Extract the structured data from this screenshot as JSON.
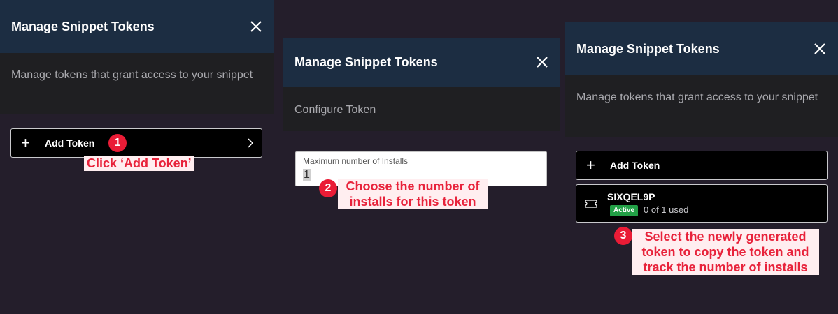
{
  "panel1": {
    "title": "Manage Snippet Tokens",
    "subtitle": "Manage tokens that grant access to your snippet",
    "add_token_label": "Add Token",
    "add_icon": "plus-icon",
    "chevron_icon": "chevron-right-icon",
    "step_number": "1",
    "callout": "Click ‘Add Token’"
  },
  "panel2": {
    "title": "Manage Snippet Tokens",
    "subtitle": "Configure Token",
    "field_label": "Maximum number of Installs",
    "field_value": "1",
    "step_number": "2",
    "callout_line1": "Choose the number of",
    "callout_line2": "installs for this token"
  },
  "panel3": {
    "title": "Manage Snippet Tokens",
    "subtitle": "Manage tokens that grant access to your snippet",
    "add_token_label": "Add Token",
    "token": {
      "code": "SIXQEL9P",
      "status": "Active",
      "usage": "0 of 1 used",
      "icon": "ticket-icon"
    },
    "step_number": "3",
    "callout_line1": "Select the newly generated",
    "callout_line2": "token to copy the token and",
    "callout_line3": "track the number of installs"
  },
  "colors": {
    "background": "#241e2b",
    "header": "#1c2d42",
    "subheader": "#1f1f22",
    "annotation_red": "#ea1c36",
    "active_green": "#22a046"
  }
}
